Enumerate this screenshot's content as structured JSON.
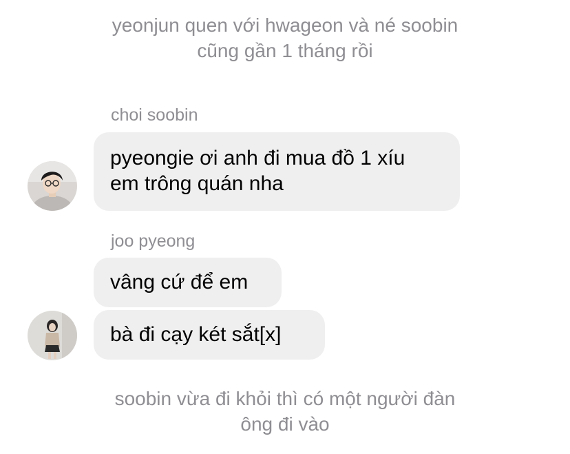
{
  "narration_top": {
    "line1": "yeonjun quen với hwageon và né soobin",
    "line2": "cũng gần 1 tháng rồi"
  },
  "messages": {
    "group1": {
      "sender": "choi soobin",
      "avatar_icon": "male-profile-photo",
      "bubble1": {
        "line1": "pyeongie ơi anh đi mua đồ 1 xíu",
        "line2": "em trông quán nha"
      }
    },
    "group2": {
      "sender": "joo pyeong",
      "avatar_icon": "female-profile-photo",
      "bubble1": "vâng cứ để em",
      "bubble2": "bà đi cạy két sắt[x]"
    }
  },
  "narration_bottom": {
    "line1": "soobin vừa đi khỏi thì có một người đàn",
    "line2": "ông đi vào"
  },
  "colors": {
    "narration_text": "#8e8e93",
    "sender_text": "#8e8e93",
    "bubble_bg": "#efeff0",
    "bubble_text": "#000000"
  }
}
